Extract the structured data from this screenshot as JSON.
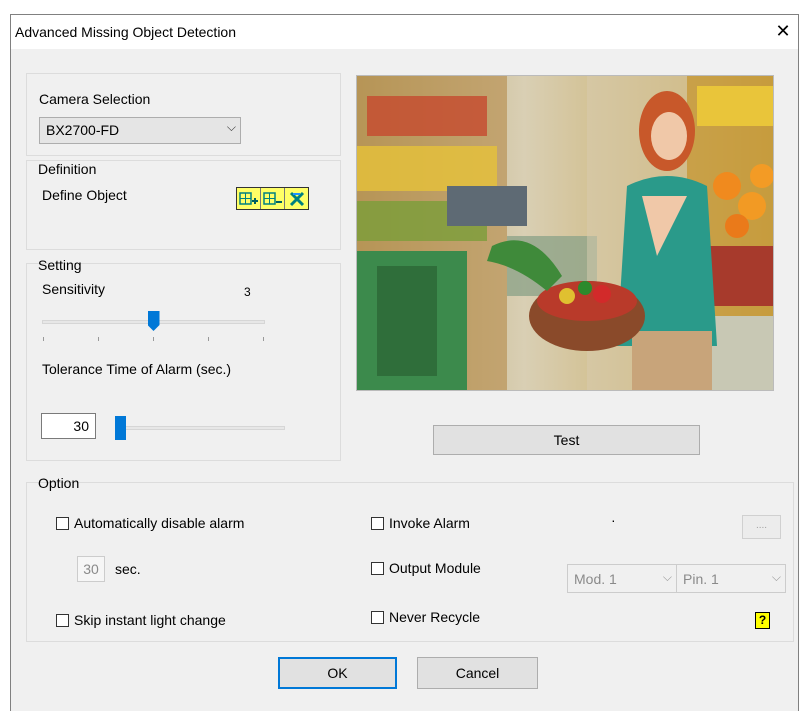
{
  "window": {
    "title": "Advanced Missing Object Detection",
    "close_glyph": "✕"
  },
  "camera": {
    "group_label": "Camera Selection",
    "selected": "BX2700-FD"
  },
  "definition": {
    "group_label": "Definition",
    "define_object_label": "Define Object",
    "tools": [
      {
        "icon": "grid-plus-icon"
      },
      {
        "icon": "grid-minus-icon"
      },
      {
        "icon": "clear-x-icon"
      }
    ]
  },
  "setting": {
    "group_label": "Setting",
    "sensitivity_label": "Sensitivity",
    "sensitivity_value": "3",
    "sensitivity_level": 0.5,
    "tolerance_label": "Tolerance Time of Alarm (sec.)",
    "tolerance_value": "30",
    "tolerance_level": 0.0
  },
  "preview": {
    "icon": "camera-preview-image"
  },
  "test_button": "Test",
  "option": {
    "group_label": "Option",
    "auto_disable_label": "Automatically disable alarm",
    "seconds_value": "30",
    "seconds_unit": "sec.",
    "skip_light_label": "Skip instant light change",
    "invoke_alarm_label": "Invoke Alarm",
    "dot": "·",
    "browse_label": "....",
    "output_module_label": "Output Module",
    "module_select": "Mod. 1",
    "pin_select": "Pin. 1",
    "never_recycle_label": "Never Recycle",
    "help_glyph": "?"
  },
  "buttons": {
    "ok": "OK",
    "cancel": "Cancel"
  },
  "colors": {
    "accent": "#0078d7",
    "tool_bg": "#ffff66",
    "help_bg": "#ffff00"
  }
}
